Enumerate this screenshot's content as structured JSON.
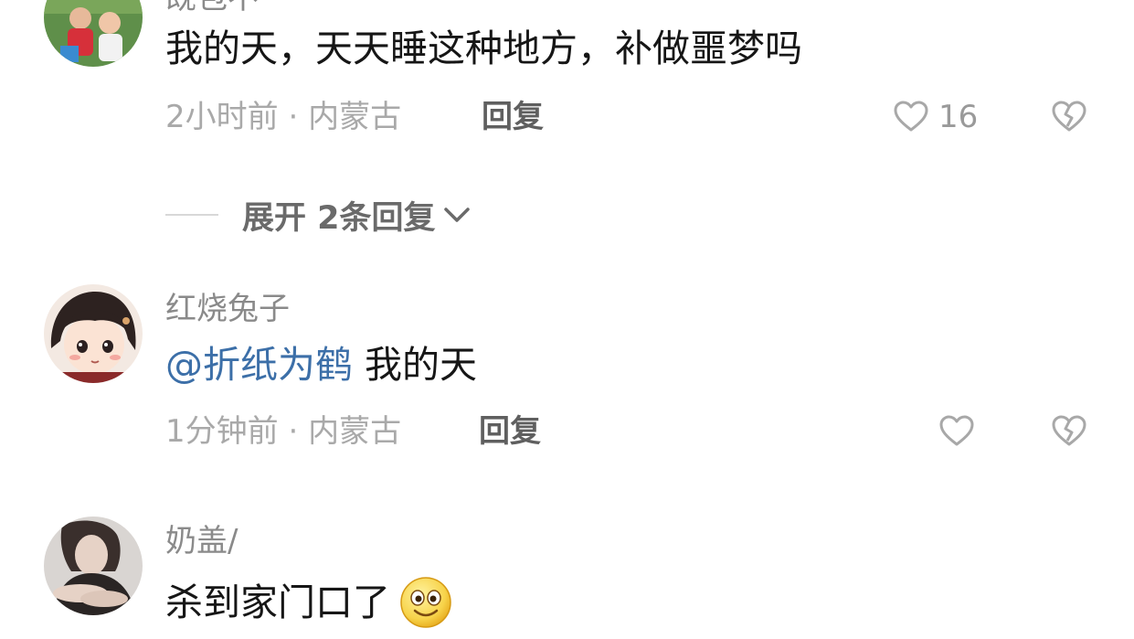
{
  "comments": [
    {
      "username": "既包不",
      "text": "我的天，天天睡这种地方，补做噩梦吗",
      "time": "2小时前",
      "location": "内蒙古",
      "reply_label": "回复",
      "likes": "16"
    },
    {
      "username": "红烧兔子",
      "mention": "@折纸为鹤",
      "text": " 我的天",
      "time": "1分钟前",
      "location": "内蒙古",
      "reply_label": "回复",
      "likes": ""
    },
    {
      "username": "奶盖/",
      "text": "杀到家门口了",
      "emoji": "smile-emoji"
    }
  ],
  "expand_replies": {
    "label": "展开 2条回复"
  },
  "meta_separator": "·",
  "icons": {
    "like": "heart-outline-icon",
    "dislike": "broken-heart-icon",
    "expand": "chevron-down-icon"
  },
  "colors": {
    "mention": "#3c6fa8",
    "meta": "#a9a9a9",
    "text": "#161616"
  }
}
